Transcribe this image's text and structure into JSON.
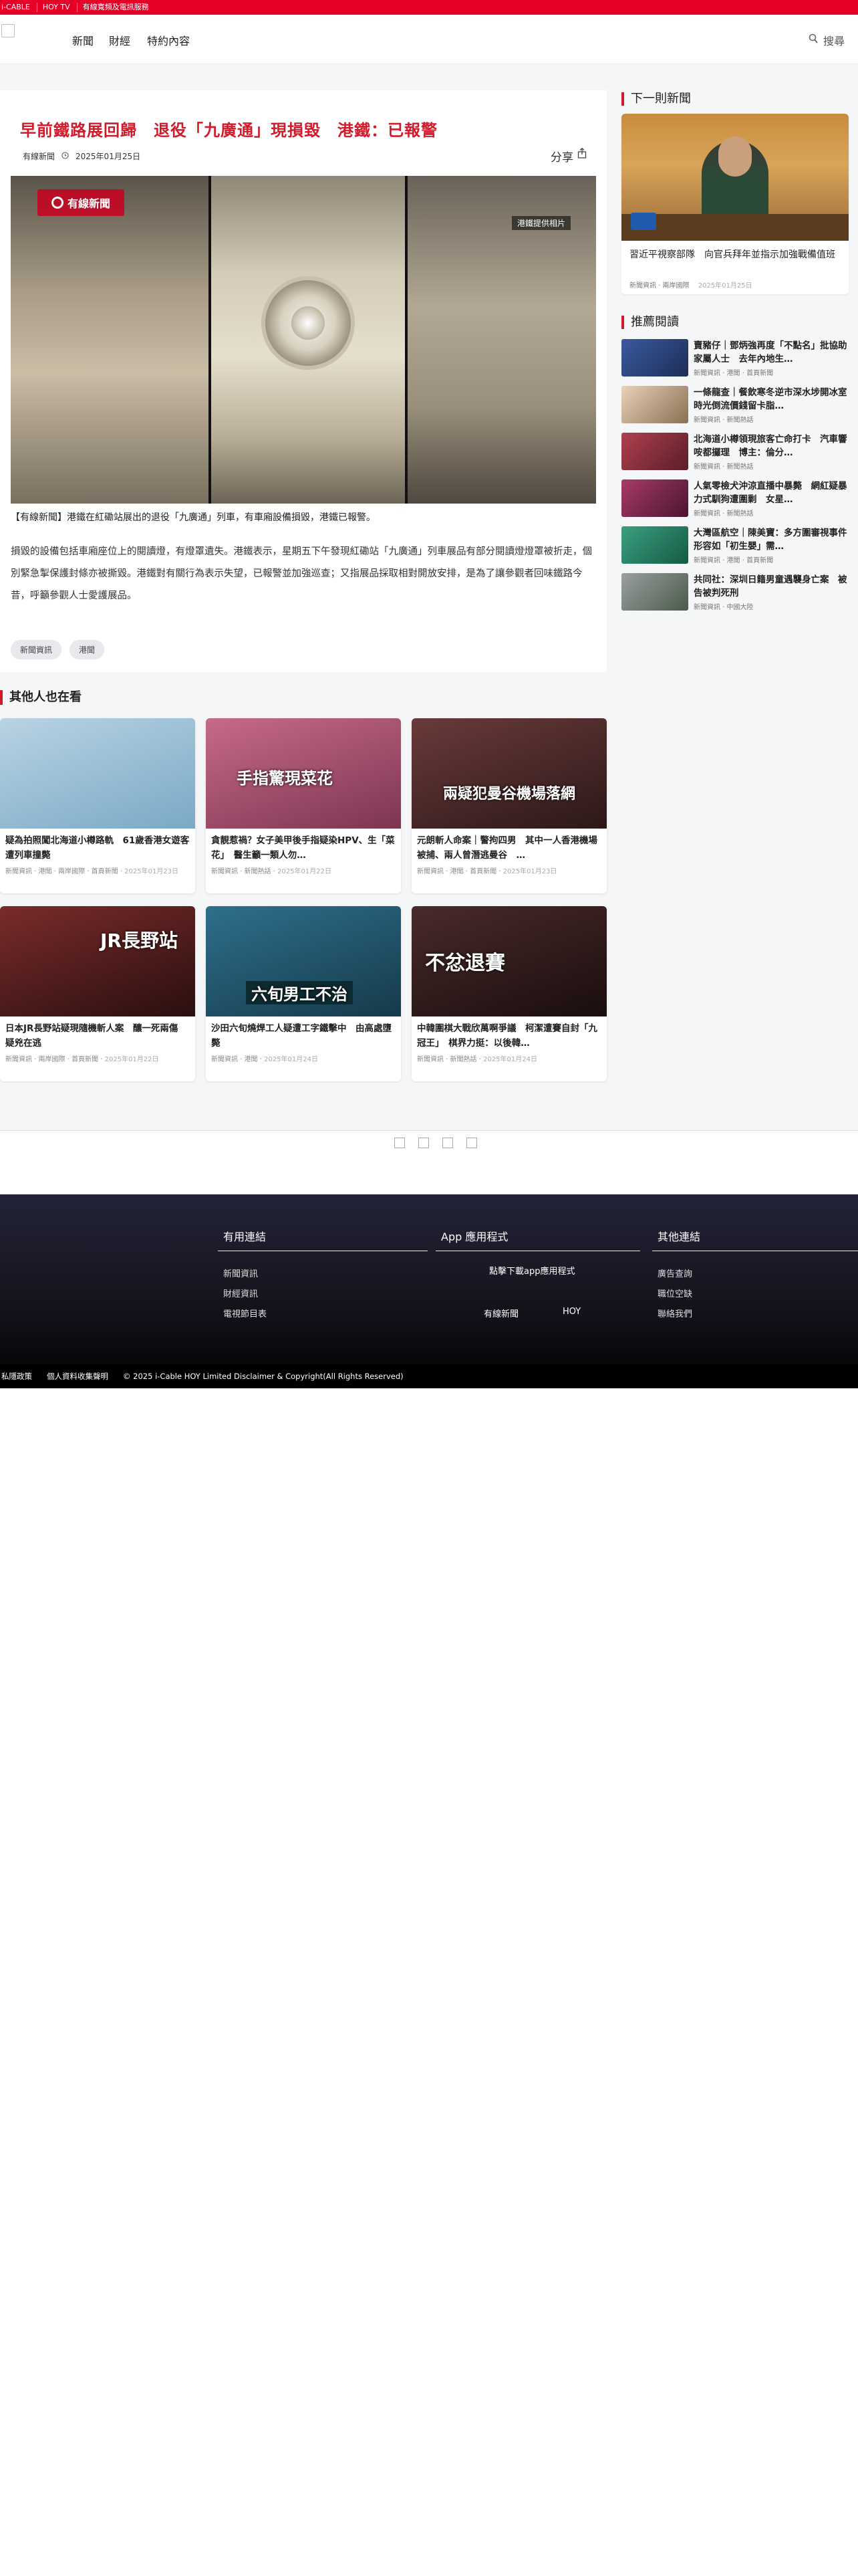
{
  "topbar": {
    "links": [
      "i-CABLE",
      "HOY TV",
      "有線寬頻及電訊服務"
    ]
  },
  "nav": {
    "items": [
      "新聞",
      "財經",
      "特約內容"
    ],
    "search_label": "搜尋"
  },
  "article": {
    "title": "早前鐵路展回歸　退役「九廣通」現損毀　港鐵：已報警",
    "source": "有線新聞",
    "date": "2025年01月25日",
    "share_label": "分享",
    "image_badge": "有線新聞",
    "image_credit": "港鐵提供相片",
    "caption": "【有線新聞】港鐵在紅磡站展出的退役「九廣通」列車，有車廂設備損毀，港鐵已報警。",
    "body": "損毀的設備包括車廂座位上的閱讀燈，有燈罩遺失。港鐵表示，星期五下午發現紅磡站「九廣通」列車展品有部分閱讀燈燈罩被折走，個別緊急掣保護封條亦被撕毀。港鐵對有關行為表示失望，已報警並加強巡查；又指展品採取相對開放安排，是為了讓參觀者回味鐵路今昔，呼籲參觀人士愛護展品。",
    "tags": [
      "新聞資訊",
      "港聞"
    ]
  },
  "next_news": {
    "heading": "下一則新聞",
    "title": "習近平視察部隊　向官兵拜年並指示加強戰備值班",
    "meta": "新聞資訊 · 兩岸國際",
    "date": "2025年01月25日"
  },
  "recommended": {
    "heading": "推薦閱讀",
    "items": [
      {
        "title": "賣豬仔｜鄧炳強再度「不點名」批協助家屬人士　去年內地生…",
        "meta": "新聞資訊 · 港聞 · 首頁新聞"
      },
      {
        "title": "一條龍查｜餐飲寒冬逆市深水埗開冰室　時光倒流價錢留卡脂…",
        "meta": "新聞資訊 · 新聞熱話"
      },
      {
        "title": "北海道小樽領現旅客亡命打卡　汽車響咹都攞理　博主：倫分…",
        "meta": "新聞資訊 · 新聞熱話"
      },
      {
        "title": "人氣零檢犬沖涼直播中暴斃　網紅疑暴力式馴狗遭圍剿　女星…",
        "meta": "新聞資訊 · 新聞熱話"
      },
      {
        "title": "大灣區航空｜陳美寶：多方圍審視事件　形容如「初生嬰」需…",
        "meta": "新聞資訊 · 港聞 · 首頁新聞"
      },
      {
        "title": "共同社：深圳日籍男童遇襲身亡案　被告被判死刑",
        "meta": "新聞資訊 · 中國大陸"
      }
    ]
  },
  "others": {
    "heading": "其他人也在看",
    "items": [
      {
        "title": "疑為拍照闖北海道小樽路軌　61歲香港女遊客遭列車撞斃",
        "meta": "新聞資訊 · 港聞 · 兩岸國際 · 首頁新聞",
        "date": "2025年01月23日",
        "overlay": "",
        "colors": [
          "#b9d3e3",
          "#7aa9c6"
        ]
      },
      {
        "title": "貪靚惹禍？女子美甲後手指疑染HPV、生「菜花」　醫生籲一類人勿…",
        "meta": "新聞資訊 · 新聞熱話",
        "date": "2025年01月22日",
        "overlay": "手指驚現菜花",
        "colors": [
          "#c76a8a",
          "#7d3551"
        ]
      },
      {
        "title": "元朗斬人命案｜警拘四男　其中一人香港機場被捕、兩人曾潛逃曼谷　…",
        "meta": "新聞資訊 · 港聞 · 首頁新聞",
        "date": "2025年01月23日",
        "overlay": "兩疑犯曼谷機場落網",
        "colors": [
          "#6a3a3a",
          "#2c1818"
        ]
      },
      {
        "title": "日本JR長野站疑現隨機斬人案　釀一死兩傷　疑兇在逃",
        "meta": "新聞資訊 · 兩岸國際 · 首頁新聞",
        "date": "2025年01月22日",
        "overlay": "JR長野站",
        "colors": [
          "#7a2b2b",
          "#2a0f0f"
        ]
      },
      {
        "title": "沙田六旬燒焊工人疑遭工字鐵擊中　由高處墮斃",
        "meta": "新聞資訊 · 港聞",
        "date": "2025年01月24日",
        "overlay": "六旬男工不治",
        "colors": [
          "#2f6f8c",
          "#153a4a"
        ]
      },
      {
        "title": "中韓圍棋大戰欣萬啊爭議　柯潔遭賽自封「九冠王」　棋界力挺：以後韓…",
        "meta": "新聞資訊 · 新聞熱話",
        "date": "2025年01月24日",
        "overlay": "不忿退賽",
        "colors": [
          "#4a2a2a",
          "#1a0e0e"
        ]
      }
    ]
  },
  "footer": {
    "col1": {
      "heading": "有用連結",
      "links": [
        "新聞資訊",
        "財經資訊",
        "電視節目表"
      ]
    },
    "col2": {
      "heading": "App 應用程式",
      "tagline": "點擊下載app應用程式",
      "apps": [
        "有線新聞",
        "HOY"
      ]
    },
    "col3": {
      "heading": "其他連結",
      "links": [
        "廣告查詢",
        "職位空缺",
        "聯絡我們"
      ]
    }
  },
  "bottom_bar": {
    "links": [
      "私隱政策",
      "個人資料收集聲明",
      "© 2025 i-Cable HOY Limited Disclaimer & Copyright(All Rights Reserved)"
    ]
  }
}
